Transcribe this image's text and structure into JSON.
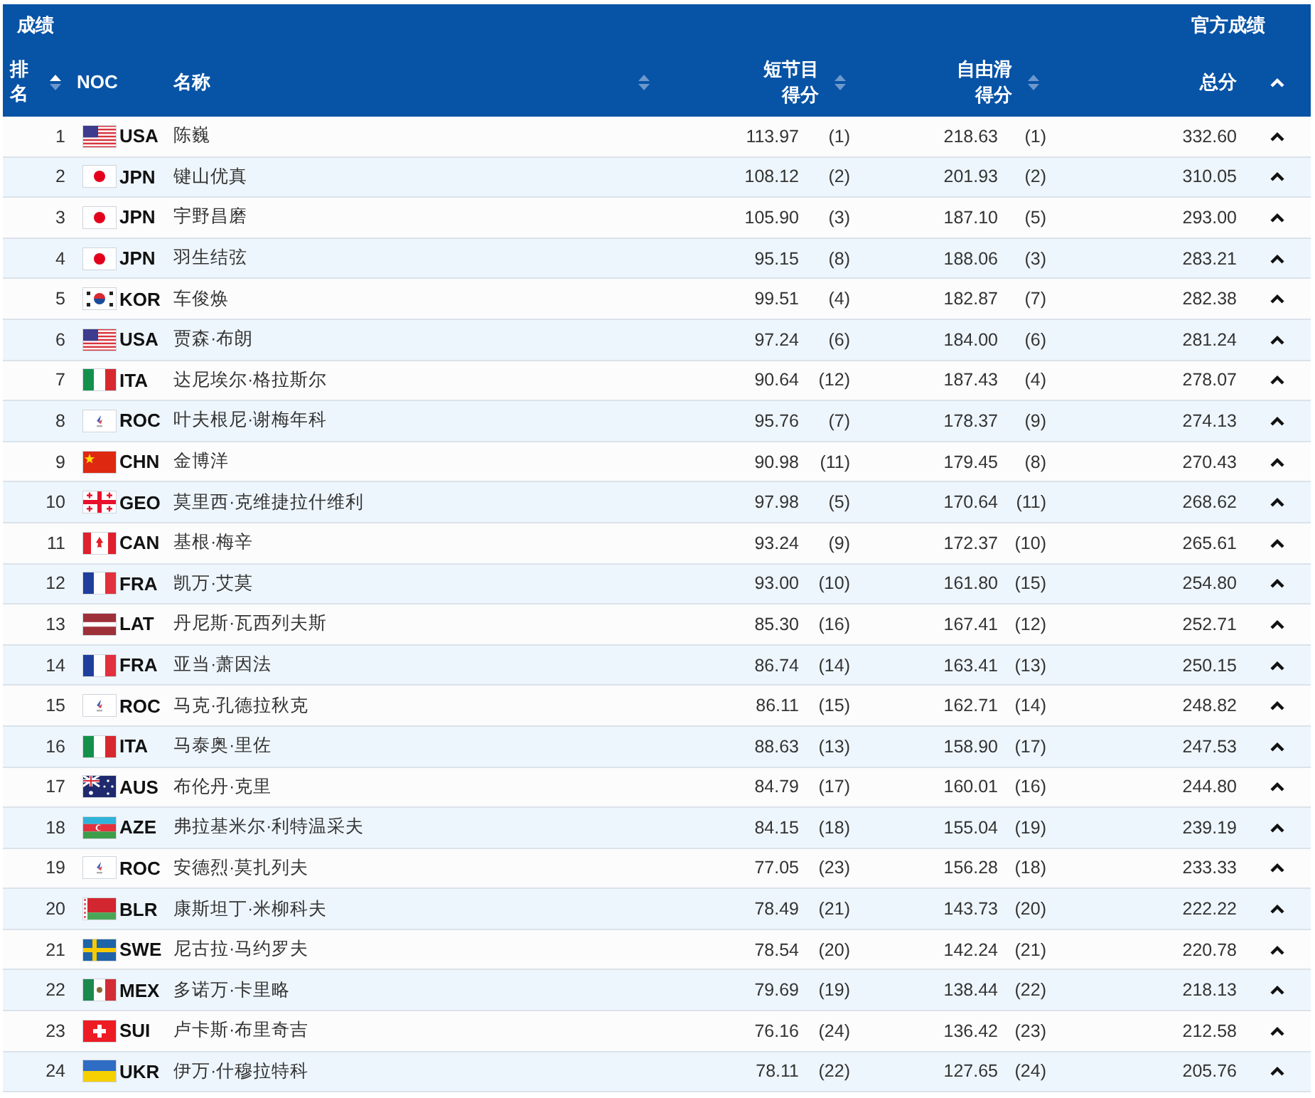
{
  "header": {
    "title": "成绩",
    "official_label": "官方成绩"
  },
  "columns": [
    {
      "kind": "rank",
      "label": "排名",
      "sorted": true
    },
    {
      "kind": "noc",
      "label": "NOC"
    },
    {
      "kind": "name",
      "label": "名称",
      "sorted": false
    },
    {
      "kind": "short",
      "label": "短节目得分",
      "sorted": false
    },
    {
      "kind": "free",
      "label": "自由滑得分",
      "sorted": false
    },
    {
      "kind": "total",
      "label": "总分",
      "chevron": true
    }
  ],
  "rows": [
    {
      "rank": "1",
      "kind": "usa",
      "noc": "USA",
      "name": "陈巍",
      "short_score": "113.97",
      "short_rank": "(1)",
      "free_score": "218.63",
      "free_rank": "(1)",
      "total": "332.60"
    },
    {
      "rank": "2",
      "kind": "jpn",
      "noc": "JPN",
      "name": "键山优真",
      "short_score": "108.12",
      "short_rank": "(2)",
      "free_score": "201.93",
      "free_rank": "(2)",
      "total": "310.05"
    },
    {
      "rank": "3",
      "kind": "jpn",
      "noc": "JPN",
      "name": "宇野昌磨",
      "short_score": "105.90",
      "short_rank": "(3)",
      "free_score": "187.10",
      "free_rank": "(5)",
      "total": "293.00"
    },
    {
      "rank": "4",
      "kind": "jpn",
      "noc": "JPN",
      "name": "羽生结弦",
      "short_score": "95.15",
      "short_rank": "(8)",
      "free_score": "188.06",
      "free_rank": "(3)",
      "total": "283.21"
    },
    {
      "rank": "5",
      "kind": "kor",
      "noc": "KOR",
      "name": "车俊焕",
      "short_score": "99.51",
      "short_rank": "(4)",
      "free_score": "182.87",
      "free_rank": "(7)",
      "total": "282.38"
    },
    {
      "rank": "6",
      "kind": "usa",
      "noc": "USA",
      "name": "贾森·布朗",
      "short_score": "97.24",
      "short_rank": "(6)",
      "free_score": "184.00",
      "free_rank": "(6)",
      "total": "281.24"
    },
    {
      "rank": "7",
      "kind": "ita",
      "noc": "ITA",
      "name": "达尼埃尔·格拉斯尔",
      "short_score": "90.64",
      "short_rank": "(12)",
      "free_score": "187.43",
      "free_rank": "(4)",
      "total": "278.07"
    },
    {
      "rank": "8",
      "kind": "roc",
      "noc": "ROC",
      "name": "叶夫根尼·谢梅年科",
      "short_score": "95.76",
      "short_rank": "(7)",
      "free_score": "178.37",
      "free_rank": "(9)",
      "total": "274.13"
    },
    {
      "rank": "9",
      "kind": "chn",
      "noc": "CHN",
      "name": "金博洋",
      "short_score": "90.98",
      "short_rank": "(11)",
      "free_score": "179.45",
      "free_rank": "(8)",
      "total": "270.43"
    },
    {
      "rank": "10",
      "kind": "geo",
      "noc": "GEO",
      "name": "莫里西·克维捷拉什维利",
      "short_score": "97.98",
      "short_rank": "(5)",
      "free_score": "170.64",
      "free_rank": "(11)",
      "total": "268.62"
    },
    {
      "rank": "11",
      "kind": "can",
      "noc": "CAN",
      "name": "基根·梅辛",
      "short_score": "93.24",
      "short_rank": "(9)",
      "free_score": "172.37",
      "free_rank": "(10)",
      "total": "265.61"
    },
    {
      "rank": "12",
      "kind": "fra",
      "noc": "FRA",
      "name": "凯万·艾莫",
      "short_score": "93.00",
      "short_rank": "(10)",
      "free_score": "161.80",
      "free_rank": "(15)",
      "total": "254.80"
    },
    {
      "rank": "13",
      "kind": "lat",
      "noc": "LAT",
      "name": "丹尼斯·瓦西列夫斯",
      "short_score": "85.30",
      "short_rank": "(16)",
      "free_score": "167.41",
      "free_rank": "(12)",
      "total": "252.71"
    },
    {
      "rank": "14",
      "kind": "fra",
      "noc": "FRA",
      "name": "亚当·萧因法",
      "short_score": "86.74",
      "short_rank": "(14)",
      "free_score": "163.41",
      "free_rank": "(13)",
      "total": "250.15"
    },
    {
      "rank": "15",
      "kind": "roc",
      "noc": "ROC",
      "name": "马克·孔德拉秋克",
      "short_score": "86.11",
      "short_rank": "(15)",
      "free_score": "162.71",
      "free_rank": "(14)",
      "total": "248.82"
    },
    {
      "rank": "16",
      "kind": "ita",
      "noc": "ITA",
      "name": "马泰奥·里佐",
      "short_score": "88.63",
      "short_rank": "(13)",
      "free_score": "158.90",
      "free_rank": "(17)",
      "total": "247.53"
    },
    {
      "rank": "17",
      "kind": "aus",
      "noc": "AUS",
      "name": "布伦丹·克里",
      "short_score": "84.79",
      "short_rank": "(17)",
      "free_score": "160.01",
      "free_rank": "(16)",
      "total": "244.80"
    },
    {
      "rank": "18",
      "kind": "aze",
      "noc": "AZE",
      "name": "弗拉基米尔·利特温采夫",
      "short_score": "84.15",
      "short_rank": "(18)",
      "free_score": "155.04",
      "free_rank": "(19)",
      "total": "239.19"
    },
    {
      "rank": "19",
      "kind": "roc",
      "noc": "ROC",
      "name": "安德烈·莫扎列夫",
      "short_score": "77.05",
      "short_rank": "(23)",
      "free_score": "156.28",
      "free_rank": "(18)",
      "total": "233.33"
    },
    {
      "rank": "20",
      "kind": "blr",
      "noc": "BLR",
      "name": "康斯坦丁·米柳科夫",
      "short_score": "78.49",
      "short_rank": "(21)",
      "free_score": "143.73",
      "free_rank": "(20)",
      "total": "222.22"
    },
    {
      "rank": "21",
      "kind": "swe",
      "noc": "SWE",
      "name": "尼古拉·马约罗夫",
      "short_score": "78.54",
      "short_rank": "(20)",
      "free_score": "142.24",
      "free_rank": "(21)",
      "total": "220.78"
    },
    {
      "rank": "22",
      "kind": "mex",
      "noc": "MEX",
      "name": "多诺万·卡里略",
      "short_score": "79.69",
      "short_rank": "(19)",
      "free_score": "138.44",
      "free_rank": "(22)",
      "total": "218.13"
    },
    {
      "rank": "23",
      "kind": "sui",
      "noc": "SUI",
      "name": "卢卡斯·布里奇吉",
      "short_score": "76.16",
      "short_rank": "(24)",
      "free_score": "136.42",
      "free_rank": "(23)",
      "total": "212.58"
    },
    {
      "rank": "24",
      "kind": "ukr",
      "noc": "UKR",
      "name": "伊万·什穆拉特科",
      "short_score": "78.11",
      "short_rank": "(22)",
      "free_score": "127.65",
      "free_rank": "(24)",
      "total": "205.76"
    }
  ]
}
